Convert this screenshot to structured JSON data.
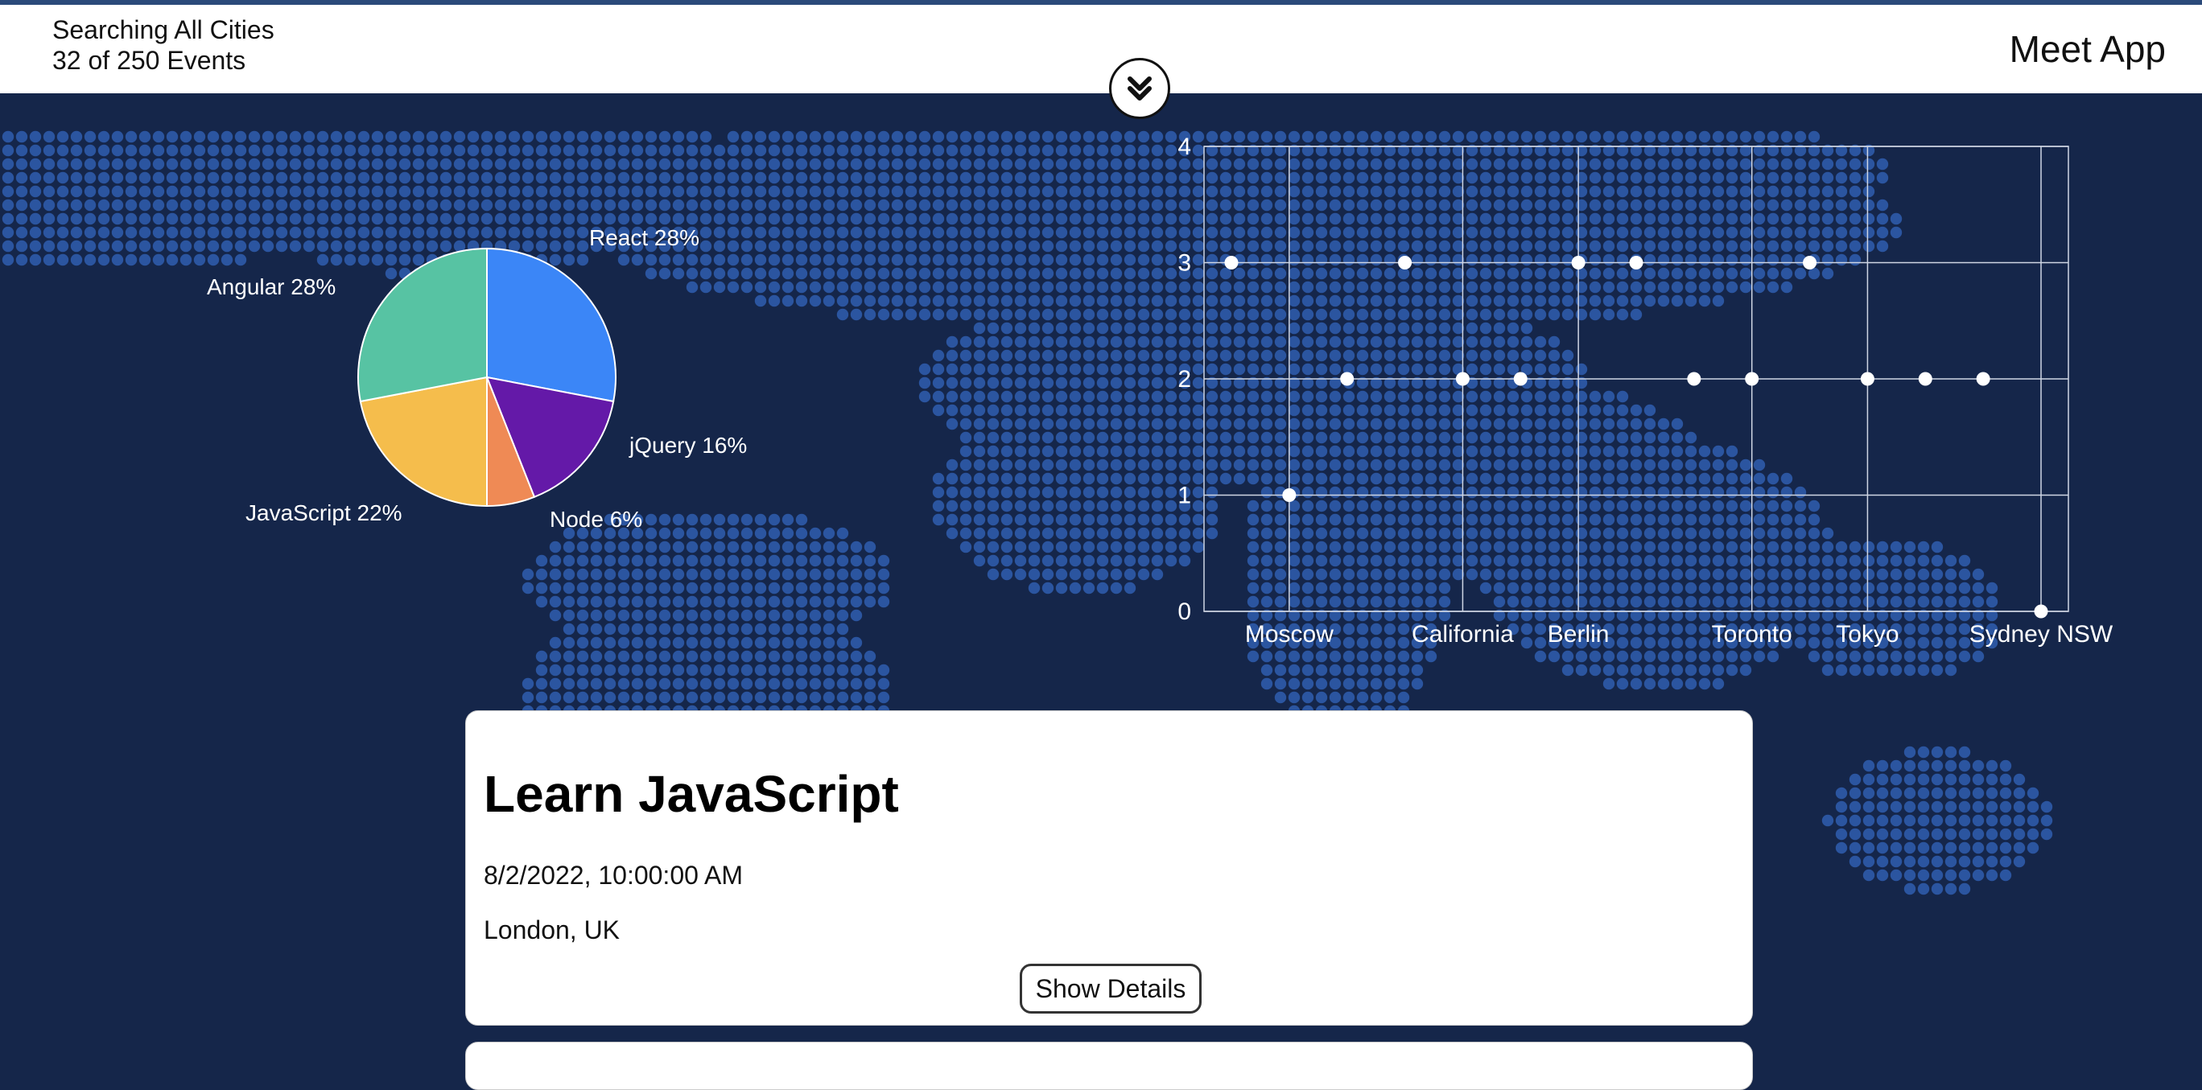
{
  "header": {
    "search_scope": "Searching All Cities",
    "event_count": "32 of 250 Events",
    "app_title": "Meet App"
  },
  "toggle": {
    "icon": "double-chevron-down-icon"
  },
  "genre_chart": {
    "type": "pie",
    "slices": [
      {
        "name": "React",
        "value": 28,
        "label": "React 28%",
        "color": "#3b86f7"
      },
      {
        "name": "jQuery",
        "value": 16,
        "label": "jQuery 16%",
        "color": "#6419a8"
      },
      {
        "name": "Node",
        "value": 6,
        "label": "Node 6%",
        "color": "#ef8a55"
      },
      {
        "name": "JavaScript",
        "value": 22,
        "label": "JavaScript 22%",
        "color": "#f5bd4c"
      },
      {
        "name": "Angular",
        "value": 28,
        "label": "Angular 28%",
        "color": "#57c3a3"
      }
    ]
  },
  "chart_data": {
    "type": "scatter",
    "title": "",
    "xlabel": "",
    "ylabel": "",
    "ylim": [
      0,
      4
    ],
    "yticks": [
      0,
      1,
      2,
      3,
      4
    ],
    "grid": true,
    "categories": [
      "",
      "Moscow",
      "",
      "",
      "California",
      "",
      "Berlin",
      "",
      "",
      "Toronto",
      "",
      "Tokyo",
      "",
      "",
      "Sydney NSW"
    ],
    "values": [
      3,
      1,
      2,
      3,
      2,
      2,
      3,
      3,
      2,
      2,
      3,
      2,
      2,
      2,
      0
    ]
  },
  "events": [
    {
      "title": "Learn JavaScript",
      "start": "8/2/2022, 10:00:00 AM",
      "location": "London, UK",
      "details_label": "Show Details"
    }
  ],
  "colors": {
    "background": "#15264a",
    "map_dots": "#2b55a0",
    "header": "#ffffff"
  }
}
